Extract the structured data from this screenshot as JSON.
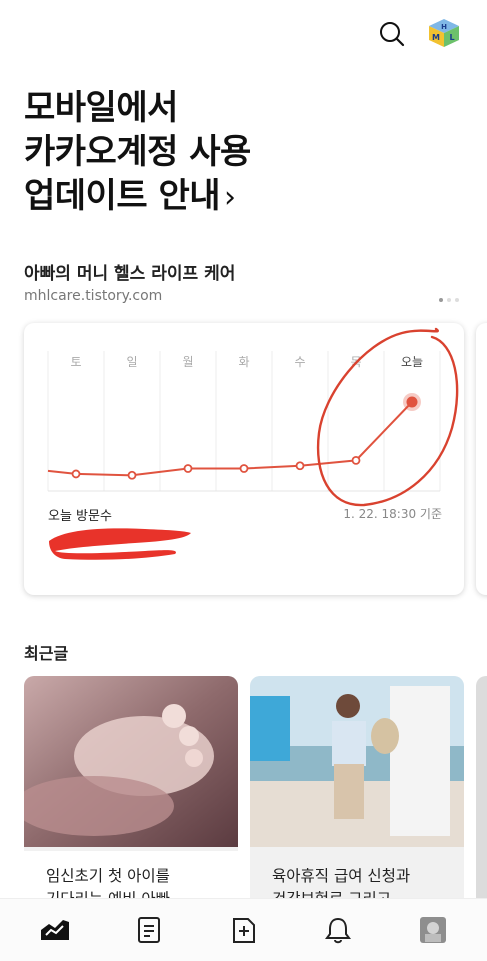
{
  "header": {
    "logo_letters": [
      "H",
      "M",
      "L"
    ]
  },
  "notice": {
    "line1": "모바일에서",
    "line2": "카카오계정 사용",
    "line3": "업데이트 안내",
    "chevron": "›"
  },
  "blog": {
    "title": "아빠의 머니 헬스 라이프 케어",
    "url": "mhlcare.tistory.com"
  },
  "stats_card": {
    "visit_label": "오늘 방문수",
    "time_label": "1. 22. 18:30 기준",
    "accent": "#e0533f",
    "chart_data": {
      "type": "line",
      "categories": [
        "토",
        "일",
        "월",
        "화",
        "수",
        "목",
        "오늘"
      ],
      "values": [
        3,
        2,
        7,
        7,
        9,
        13,
        56
      ],
      "highlight": "오늘",
      "ylim": [
        0,
        70
      ],
      "grid": true
    }
  },
  "recent": {
    "section_title": "최근글",
    "posts": [
      {
        "title_line1": "임신초기 첫 아이를",
        "title_line2": "기다리는 예비 아빠 ..."
      },
      {
        "title_line1": "육아휴직 급여 신청과",
        "title_line2": "건강보험료 그리고..."
      }
    ]
  },
  "bottom_nav": {
    "items": [
      "stats-icon",
      "posts-icon",
      "write-icon",
      "bell-icon",
      "profile-avatar"
    ],
    "active": "stats-icon"
  }
}
